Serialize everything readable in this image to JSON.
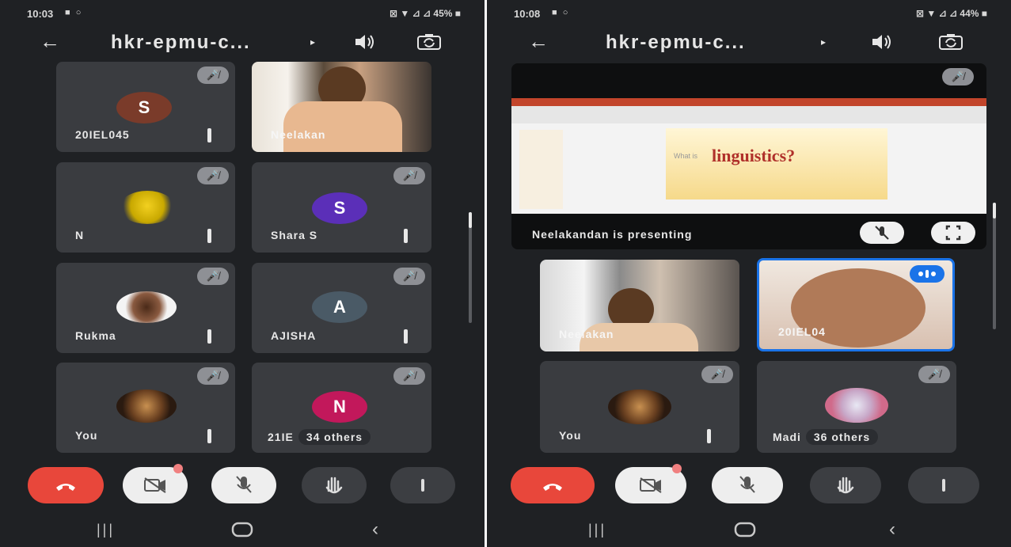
{
  "left": {
    "status": {
      "time": "10:03",
      "left_icons": "■ ○",
      "right_icons": "⊠ ▼ ⊿ ⊿ 45% ■"
    },
    "header": {
      "title": "hkr-epmu-c..."
    },
    "tiles": [
      {
        "name": "20IEL045",
        "avatar_letter": "S",
        "avatar_color": "#7a3b2a"
      },
      {
        "name": "Neelakan"
      },
      {
        "name": "N"
      },
      {
        "name": "Shara S",
        "avatar_letter": "S",
        "avatar_color": "#5b2fb8"
      },
      {
        "name": "Rukma"
      },
      {
        "name": "AJISHA",
        "avatar_letter": "A",
        "avatar_color": "#4a5a66"
      },
      {
        "name": "You"
      },
      {
        "name": "21IE",
        "others": "34 others",
        "avatar_letter": "N",
        "avatar_color": "#c2185b"
      }
    ]
  },
  "right": {
    "status": {
      "time": "10:08",
      "left_icons": "■ ○",
      "right_icons": "⊠ ▼ ⊿ ⊿ 44% ■"
    },
    "header": {
      "title": "hkr-epmu-c..."
    },
    "presentation": {
      "slide_text": "linguistics?",
      "slide_small": "What is",
      "label": "Neelakandan is presenting"
    },
    "tiles": [
      {
        "name": "Neelakan"
      },
      {
        "name": "20IEL04"
      },
      {
        "name": "You"
      },
      {
        "name": "Madi",
        "others": "36 others"
      }
    ]
  },
  "colors": {
    "end_call": "#e8473b",
    "panel": "#1f2124",
    "tile": "#3a3c40",
    "speaking_border": "#1a73e8"
  }
}
